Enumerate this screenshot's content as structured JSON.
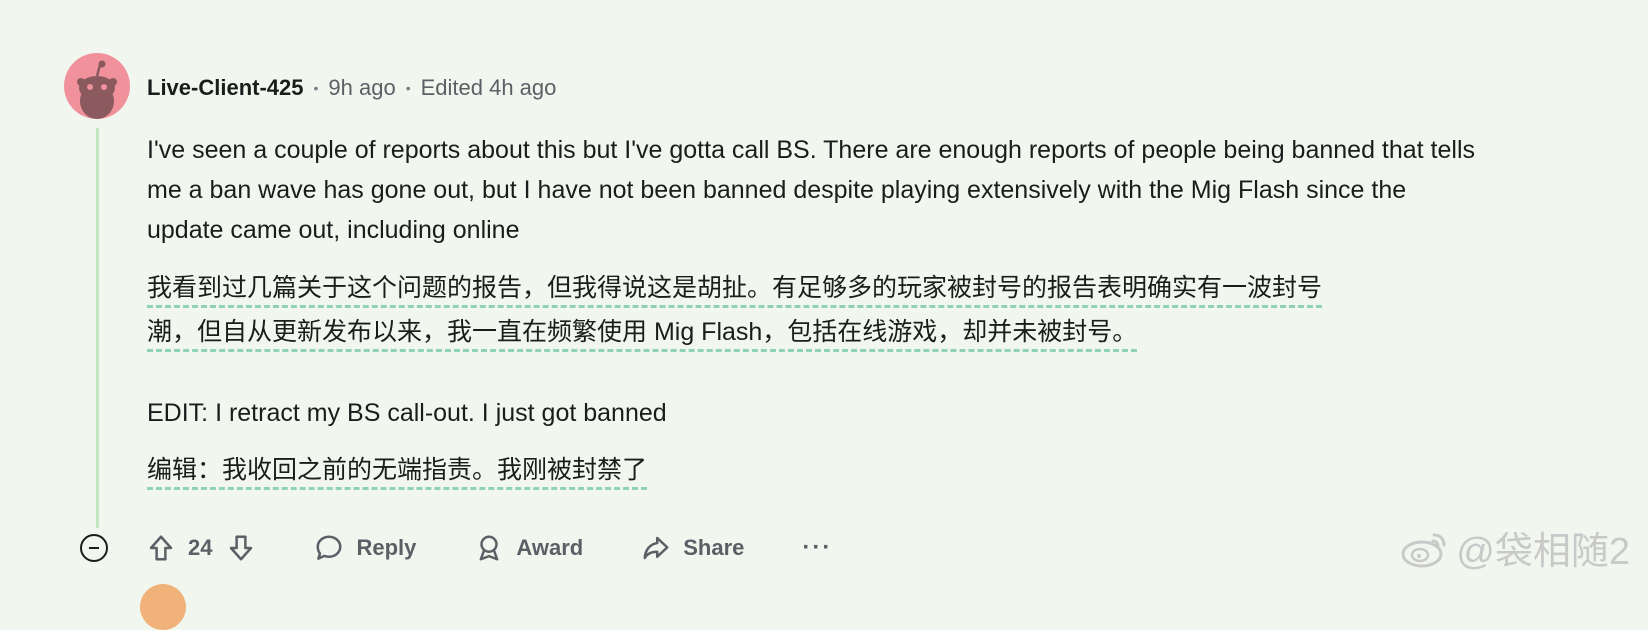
{
  "comment": {
    "username": "Live-Client-425",
    "time": "9h ago",
    "edited": "Edited 4h ago",
    "text_en_1": "I've seen a couple of reports about this but I've gotta call BS. There are enough reports of people being banned that tells me a ban wave has gone out, but I have not been banned despite playing extensively with the Mig Flash since the update came out, including online",
    "text_zh_1_line1": "我看到过几篇关于这个问题的报告，但我得说这是胡扯。有足够多的玩家被封号的报告表明确实有一波封号",
    "text_zh_1_line2": "潮，但自从更新发布以来，我一直在频繁使用 Mig Flash，包括在线游戏，却并未被封号。",
    "text_en_2": "EDIT: I retract my BS call-out. I just got banned",
    "text_zh_2": "编辑：我收回之前的无端指责。我刚被封禁了"
  },
  "actions": {
    "score": "24",
    "reply_label": "Reply",
    "award_label": "Award",
    "share_label": "Share",
    "more_label": "···"
  },
  "watermark": {
    "text": "@袋相随2"
  },
  "icons": {
    "collapse": "collapse-minus-icon",
    "upvote": "upvote-arrow-icon",
    "downvote": "downvote-arrow-icon",
    "reply": "speech-bubble-icon",
    "award": "award-ribbon-icon",
    "share": "share-arrow-icon",
    "avatar": "snoo-avatar-icon",
    "watermark_logo": "weibo-logo-icon"
  },
  "colors": {
    "background": "#f1f7ee",
    "avatar": "#f0919b",
    "thread_line": "#bfe7c0",
    "translation_underline": "#8fd2b7"
  }
}
